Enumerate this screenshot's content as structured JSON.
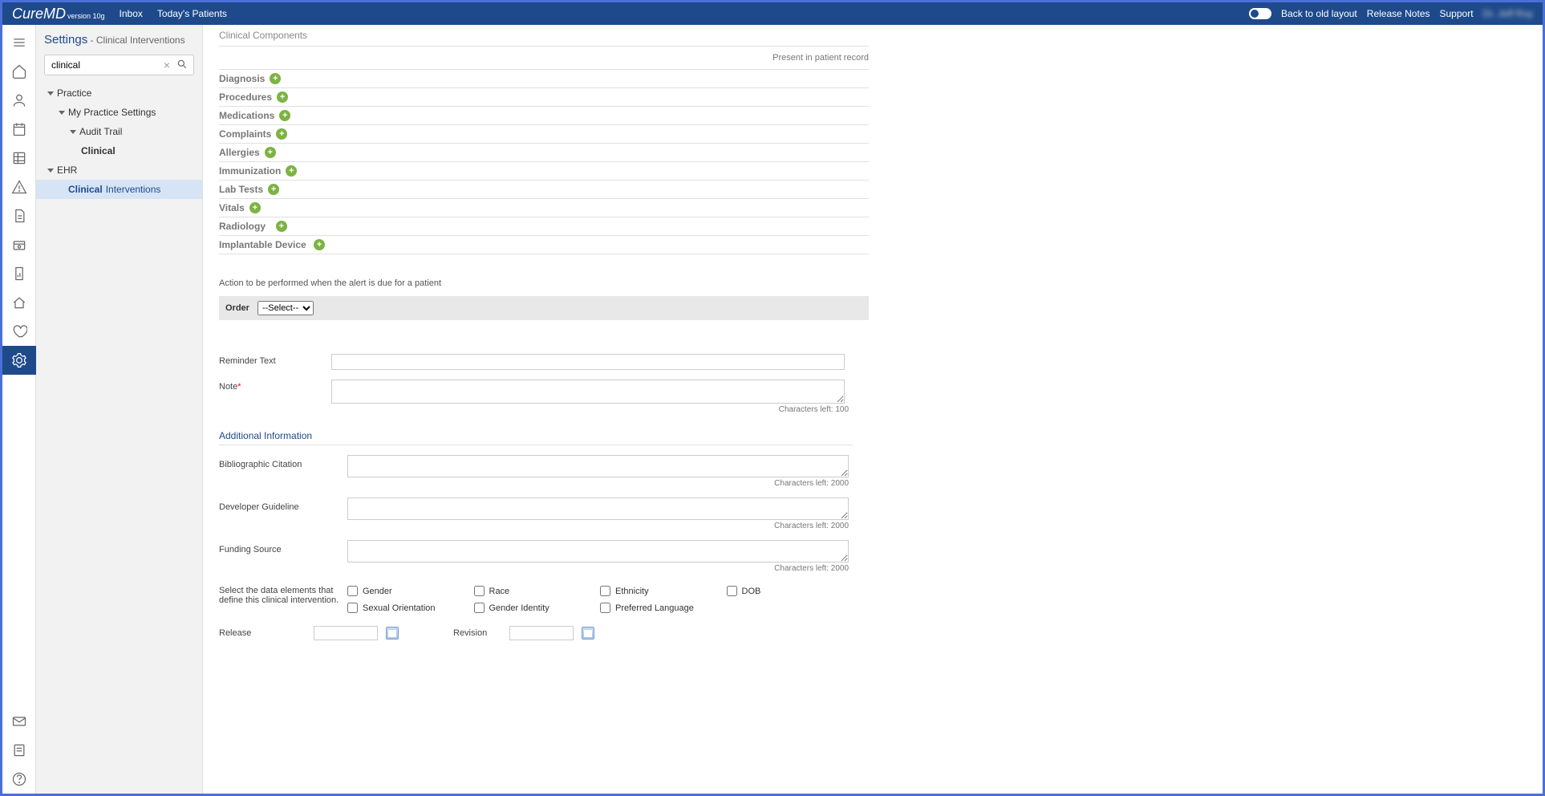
{
  "topbar": {
    "logo_main": "CureMD",
    "logo_ver": "version 10g",
    "nav": {
      "inbox": "Inbox",
      "todays_patients": "Today's Patients"
    },
    "right": {
      "back": "Back to old layout",
      "release": "Release Notes",
      "support": "Support"
    }
  },
  "sidepanel": {
    "title": "Settings",
    "subtitle": " - Clinical Interventions",
    "search_value": "clinical",
    "tree": {
      "practice": "Practice",
      "my_practice": "My Practice Settings",
      "audit_trail": "Audit Trail",
      "clinical": "Clinical",
      "ehr": "EHR",
      "clinical_interventions_prefix": "Clinical",
      "clinical_interventions_suffix": " Interventions"
    }
  },
  "content": {
    "clinical_components": "Clinical Components",
    "present_in_record": "Present in patient record",
    "components": {
      "diagnosis": "Diagnosis",
      "procedures": "Procedures",
      "medications": "Medications",
      "complaints": "Complaints",
      "allergies": "Allergies",
      "immunization": "Immunization",
      "lab_tests": "Lab Tests",
      "vitals": "Vitals",
      "radiology": "Radiology",
      "implantable": "Implantable Device"
    },
    "action_text": "Action to be performed when the alert is due for a patient",
    "order_label": "Order",
    "order_select": "--Select--",
    "reminder_text_label": "Reminder Text",
    "note_label": "Note",
    "char_left_100": "Characters left: 100",
    "additional_info": "Additional Information",
    "biblio_label": "Bibliographic Citation",
    "char_left_2000": "Characters left: 2000",
    "dev_guideline_label": "Developer Guideline",
    "funding_label": "Funding Source",
    "data_elements_label": "Select the data elements that define this clinical intervention.",
    "checkboxes": {
      "gender": "Gender",
      "race": "Race",
      "ethnicity": "Ethnicity",
      "dob": "DOB",
      "sexual_orientation": "Sexual Orientation",
      "gender_identity": "Gender Identity",
      "preferred_language": "Preferred Language"
    },
    "release_label": "Release",
    "revision_label": "Revision"
  }
}
